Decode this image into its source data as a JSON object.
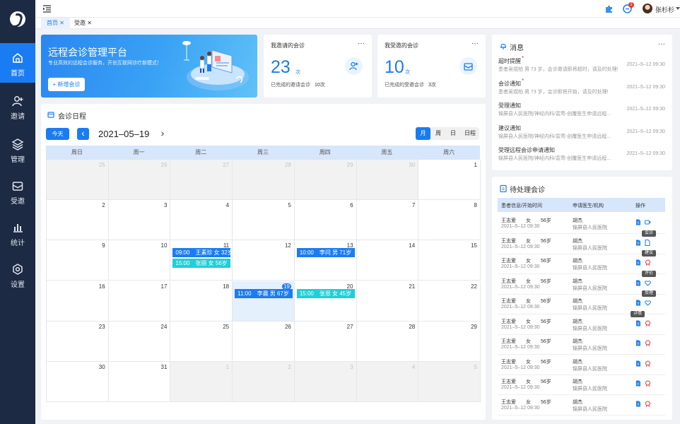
{
  "user": {
    "name": "张杉杉"
  },
  "notification_badge": "2",
  "sidebar": {
    "items": [
      {
        "label": "首页",
        "icon": "home-icon"
      },
      {
        "label": "邀请",
        "icon": "add-user-icon"
      },
      {
        "label": "管理",
        "icon": "layers-icon"
      },
      {
        "label": "受邀",
        "icon": "mail-icon"
      },
      {
        "label": "统计",
        "icon": "bar-chart-icon"
      },
      {
        "label": "设置",
        "icon": "gear-icon"
      }
    ]
  },
  "tabs": [
    {
      "label": "首页",
      "close": "✕"
    },
    {
      "label": "受邀",
      "close": "✕"
    }
  ],
  "banner": {
    "title": "远程会诊管理平台",
    "subtitle": "专业高效的远程会诊服务，开创互联网诊疗新模式！",
    "button": "+ 新增会诊"
  },
  "stat_invited": {
    "title": "我邀请的会诊",
    "value": "23",
    "unit": "次",
    "completed_label": "已完成的邀请会诊",
    "completed_value": "10次",
    "more": "···"
  },
  "stat_received": {
    "title": "我受邀的会诊",
    "value": "10",
    "unit": "次",
    "completed_label": "已完成的受邀会诊",
    "completed_value": "3次",
    "more": "···"
  },
  "calendar": {
    "title": "会诊日程",
    "today_button": "今天",
    "prev": "‹",
    "next": "›",
    "current_date": "2021–05–19",
    "views": [
      "月",
      "周",
      "日",
      "日程"
    ],
    "active_view": "月",
    "weekdays": [
      "周日",
      "周一",
      "周二",
      "周三",
      "周四",
      "周五",
      "周六"
    ],
    "days": [
      "25",
      "26",
      "27",
      "28",
      "29",
      "30",
      "1",
      "2",
      "3",
      "4",
      "5",
      "6",
      "7",
      "8",
      "9",
      "10",
      "11",
      "12",
      "13",
      "14",
      "15",
      "16",
      "17",
      "18",
      "19",
      "20",
      "21",
      "22",
      "23",
      "24",
      "25",
      "26",
      "27",
      "28",
      "29",
      "30",
      "31",
      "1",
      "2",
      "3",
      "4",
      "5"
    ],
    "events": [
      {
        "cell": 16,
        "slot": 0,
        "text": "09:00　王素珍 女 32岁",
        "color": "#1a7cf2"
      },
      {
        "cell": 16,
        "slot": 1,
        "text": "15:00　张丽 女 56岁",
        "color": "#1ecfd8"
      },
      {
        "cell": 18,
        "slot": 0,
        "text": "10:00　李问 男 71岁",
        "color": "#1a7cf2"
      },
      {
        "cell": 24,
        "slot": 0,
        "text": "11:00　李晨 男 67岁",
        "color": "#1a7cf2"
      },
      {
        "cell": 25,
        "slot": 0,
        "text": "15:00　张恩 女 45岁",
        "color": "#1ecfd8"
      }
    ]
  },
  "messages": {
    "title": "消息",
    "more": "···",
    "items": [
      {
        "title": "超时提醒",
        "dot": true,
        "sub": "患者吴煜柏 男 73 岁，会诊邀请即将超时，请及时处理!",
        "time": "2021–5–12 09:30"
      },
      {
        "title": "会诊通知",
        "dot": true,
        "sub": "患者吴煜柏 男 73 岁，会诊即将开始，请及时处理!",
        "time": "2021–5–12 09:30"
      },
      {
        "title": "受理通知",
        "dot": false,
        "sub": "锦屏县人民医院/神经内科/袁莺-创覆医生申请远程...",
        "time": "2021–5–12 09:30"
      },
      {
        "title": "建议通知",
        "dot": false,
        "sub": "锦屏县人民医院/神经内科/袁莺-创覆医生申请远程...",
        "time": "2021–5–12 09:30"
      },
      {
        "title": "受理远程会诊申请通知",
        "dot": false,
        "sub": "锦屏县人民医院/神经内科/袁莺-创覆医生申请远程...",
        "time": "2021–5–12 09:30"
      }
    ]
  },
  "pending": {
    "title": "待处理会诊",
    "columns": [
      "患者信息/开始时间",
      "申请医生/机构",
      "操作"
    ],
    "rows": [
      {
        "patient": "王志爱　　女　　56岁",
        "time": "2021–5–12 09:30",
        "doctor": "胡杰",
        "org": "锦屏县人民医院"
      },
      {
        "patient": "王志爱　　女　　56岁",
        "time": "2021–5–12 09:30",
        "doctor": "胡杰",
        "org": "锦屏县人民医院"
      },
      {
        "patient": "王志爱　　女　　56岁",
        "time": "2021–5–12 09:30",
        "doctor": "胡杰",
        "org": "锦屏县人民医院"
      },
      {
        "patient": "王志爱　　女　　56岁",
        "time": "2021–5–12 09:30",
        "doctor": "胡杰",
        "org": "锦屏县人民医院"
      },
      {
        "patient": "王志爱　　女　　56岁",
        "time": "2021–5–12 09:30",
        "doctor": "胡杰",
        "org": "锦屏县人民医院"
      },
      {
        "patient": "王志爱　　女　　56岁",
        "time": "2021–5–12 09:30",
        "doctor": "胡杰",
        "org": "锦屏县人民医院"
      },
      {
        "patient": "王志爱　　女　　56岁",
        "time": "2021–5–12 09:30",
        "doctor": "胡杰",
        "org": "锦屏县人民医院"
      },
      {
        "patient": "王志爱　　女　　56岁",
        "time": "2021–5–12 09:30",
        "doctor": "胡杰",
        "org": "锦屏县人民医院"
      },
      {
        "patient": "王志爱　　女　　56岁",
        "time": "2021–5–12 09:30",
        "doctor": "胡杰",
        "org": "锦屏县人民医院"
      },
      {
        "patient": "王志爱　　女　　56岁",
        "time": "2021–5–12 09:30",
        "doctor": "胡杰",
        "org": "锦屏县人民医院"
      }
    ],
    "tooltips": [
      "会诊",
      "建议",
      "评价",
      "受理",
      "详情"
    ]
  },
  "colors": {
    "primary": "#1a7cf2",
    "teal": "#1ecfd8",
    "sidebar": "#1c2a44",
    "danger": "#e5333f"
  }
}
